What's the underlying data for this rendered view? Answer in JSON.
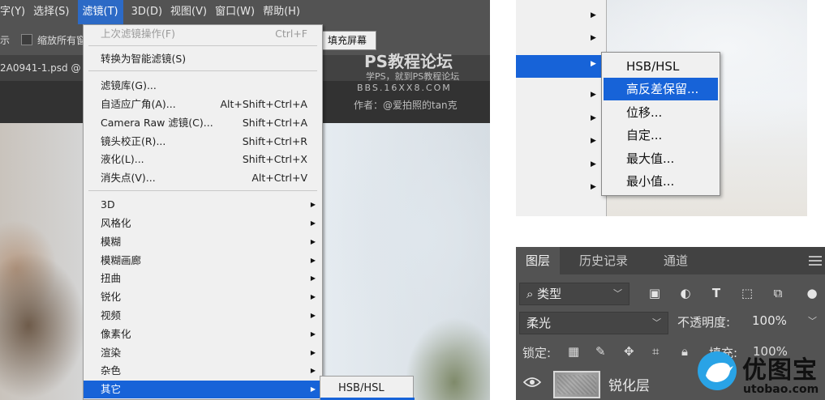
{
  "menubar": {
    "items": [
      "字(Y)",
      "选择(S)",
      "滤镜(T)",
      "3D(D)",
      "视图(V)",
      "窗口(W)",
      "帮助(H)"
    ]
  },
  "options_bar": {
    "left_fragment": "示",
    "checkbox_label": "缩放所有窗",
    "fill_screen_button": "填充屏幕"
  },
  "doc_tab": {
    "title": "2A0941-1.psd @"
  },
  "watermark": {
    "line1": "PS教程论坛",
    "line2": "学PS，就到PS教程论坛",
    "line3": "BBS.16XX8.COM",
    "line4": "作者：@爱拍照的tan克"
  },
  "filter_menu": {
    "items": [
      {
        "label": "上次滤镜操作(F)",
        "shortcut": "Ctrl+F",
        "disabled": true
      },
      {
        "label": "转换为智能滤镜(S)",
        "shortcut": ""
      },
      {
        "label": "滤镜库(G)...",
        "shortcut": ""
      },
      {
        "label": "自适应广角(A)...",
        "shortcut": "Alt+Shift+Ctrl+A"
      },
      {
        "label": "Camera Raw 滤镜(C)...",
        "shortcut": "Shift+Ctrl+A"
      },
      {
        "label": "镜头校正(R)...",
        "shortcut": "Shift+Ctrl+R"
      },
      {
        "label": "液化(L)...",
        "shortcut": "Shift+Ctrl+X"
      },
      {
        "label": "消失点(V)...",
        "shortcut": "Alt+Ctrl+V"
      },
      {
        "label": "3D",
        "submenu": true
      },
      {
        "label": "风格化",
        "submenu": true
      },
      {
        "label": "模糊",
        "submenu": true
      },
      {
        "label": "模糊画廊",
        "submenu": true
      },
      {
        "label": "扭曲",
        "submenu": true
      },
      {
        "label": "锐化",
        "submenu": true
      },
      {
        "label": "视频",
        "submenu": true
      },
      {
        "label": "像素化",
        "submenu": true
      },
      {
        "label": "渲染",
        "submenu": true
      },
      {
        "label": "杂色",
        "submenu": true
      },
      {
        "label": "其它",
        "submenu": true,
        "highlighted": true
      }
    ],
    "submenu_preview_item": "HSB/HSL"
  },
  "other_submenu": {
    "items": [
      "HSB/HSL",
      "高反差保留...",
      "位移...",
      "自定...",
      "最大值...",
      "最小值..."
    ],
    "highlighted_index": 1
  },
  "layers_panel": {
    "tabs": [
      "图层",
      "历史记录",
      "通道"
    ],
    "active_tab": 0,
    "filter_type": "类型",
    "blend_mode": "柔光",
    "opacity_label": "不透明度:",
    "opacity_value": "100%",
    "lock_label": "锁定:",
    "fill_label": "填充:",
    "fill_value": "100%",
    "layer_name": "锐化层"
  },
  "logo": {
    "text": "优图宝",
    "url": "utobao.com"
  },
  "colors": {
    "highlight": "#1763d8",
    "panel_bg": "#535353",
    "menu_bg": "#f0f0f0",
    "logo_blue": "#29a3e6"
  }
}
